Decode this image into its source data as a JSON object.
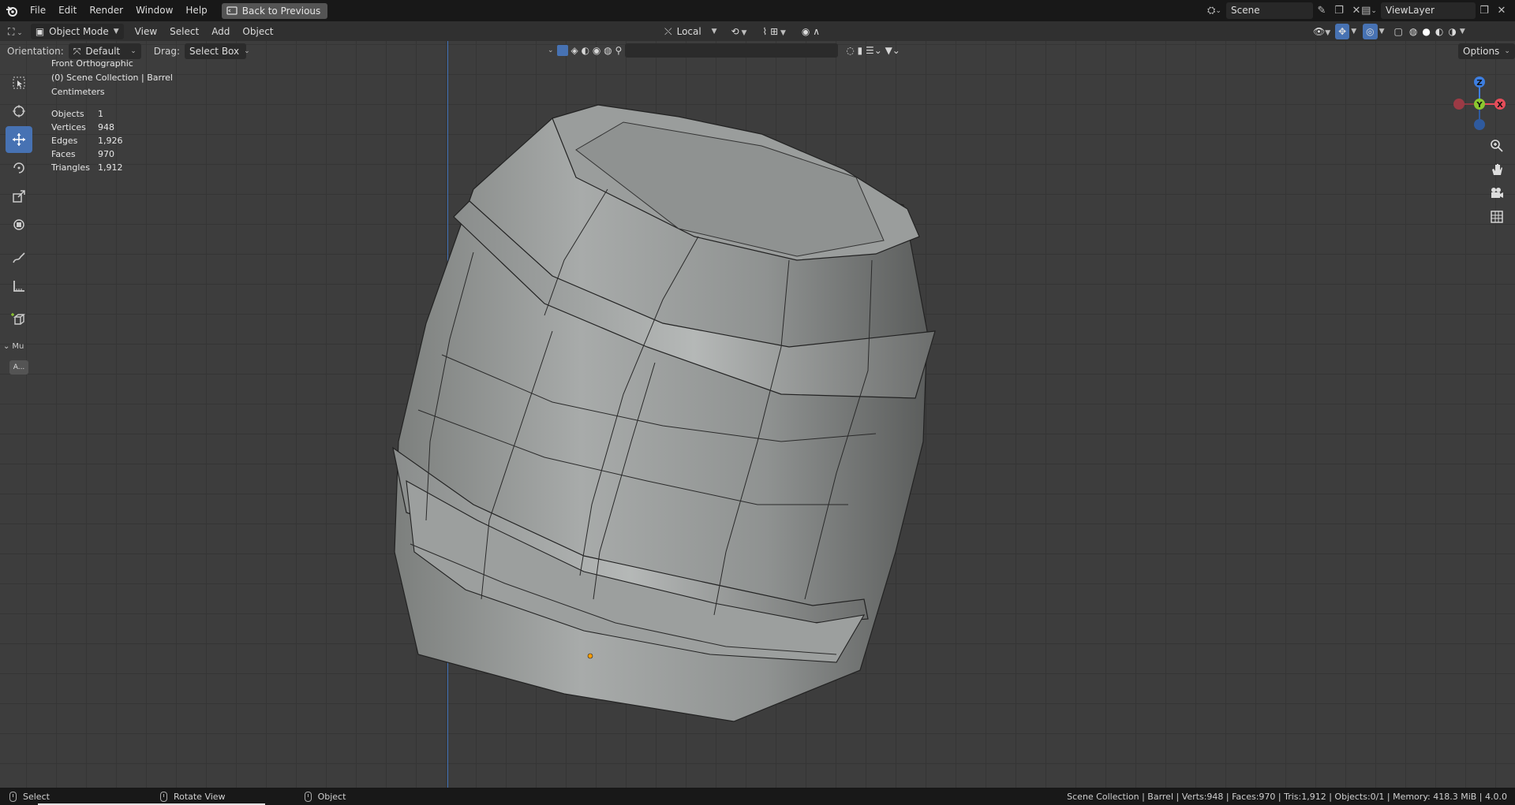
{
  "topbar": {
    "menus": [
      "File",
      "Edit",
      "Render",
      "Window",
      "Help"
    ],
    "back_button": "Back to Previous",
    "scene_name": "Scene",
    "view_layer": "ViewLayer"
  },
  "header": {
    "mode": "Object Mode",
    "menus": [
      "View",
      "Select",
      "Add",
      "Object"
    ],
    "transform_orientation": "Local",
    "options": "Options"
  },
  "tool_settings": {
    "orientation_label": "Orientation:",
    "orientation_value": "Default",
    "drag_label": "Drag:",
    "drag_value": "Select Box"
  },
  "toolbar": {
    "tools": [
      "select-box",
      "cursor",
      "move",
      "rotate",
      "scale",
      "transform",
      "annotate",
      "measure",
      "add-cube"
    ],
    "active_tool": "move",
    "panel_label": "Mu",
    "panel_button": "A..."
  },
  "viewport_info": {
    "view_name": "Front Orthographic",
    "collection": "(0) Scene Collection | Barrel",
    "units": "Centimeters",
    "stats": [
      {
        "label": "Objects",
        "value": "1"
      },
      {
        "label": "Vertices",
        "value": "948"
      },
      {
        "label": "Edges",
        "value": "1,926"
      },
      {
        "label": "Faces",
        "value": "970"
      },
      {
        "label": "Triangles",
        "value": "1,912"
      }
    ]
  },
  "gizmo": {
    "x": "X",
    "y": "Y",
    "z": "Z"
  },
  "statusbar": {
    "select": "Select",
    "rotate": "Rotate View",
    "object": "Object",
    "stats": "Scene Collection | Barrel | Verts:948 | Faces:970 | Tris:1,912 | Objects:0/1 | Memory: 418.3 MiB | 4.0.0"
  },
  "colors": {
    "accent": "#4772b3",
    "axis_x": "#e64d5a",
    "axis_y": "#8bc62f",
    "axis_z": "#3d7ee0"
  }
}
